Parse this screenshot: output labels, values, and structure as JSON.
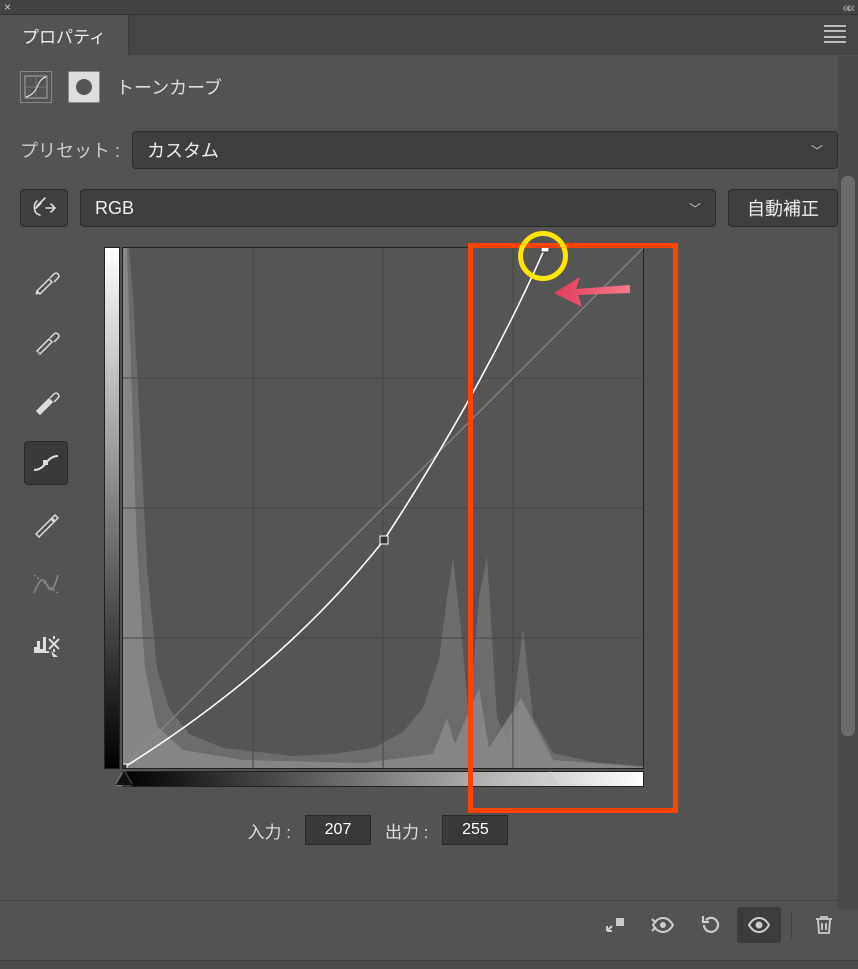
{
  "panel": {
    "tab_title": "プロパティ",
    "adjustment_title": "トーンカーブ"
  },
  "preset": {
    "label": "プリセット :",
    "value": "カスタム"
  },
  "channel": {
    "value": "RGB",
    "auto_label": "自動補正"
  },
  "io": {
    "input_label": "入力 :",
    "input_value": "207",
    "output_label": "出力 :",
    "output_value": "255"
  },
  "icons": {
    "hand": "hand-modify-icon",
    "eyedrop_black": "eyedropper-black-point",
    "eyedrop_gray": "eyedropper-gray-point",
    "eyedrop_white": "eyedropper-white-point",
    "curve_tool": "curve-point-tool",
    "pencil": "pencil-freehand-tool",
    "smooth": "smooth-curve-tool",
    "clip_hist": "clip-histogram-tool"
  },
  "chart_data": {
    "type": "line",
    "title": "トーンカーブ",
    "xlabel": "入力",
    "ylabel": "出力",
    "xlim": [
      0,
      255
    ],
    "ylim": [
      0,
      255
    ],
    "series": [
      {
        "name": "baseline",
        "x": [
          0,
          255
        ],
        "y": [
          0,
          255
        ]
      },
      {
        "name": "curve",
        "x": [
          0,
          128,
          207
        ],
        "y": [
          0,
          112,
          255
        ]
      }
    ],
    "control_points": [
      {
        "x": 0,
        "y": 0
      },
      {
        "x": 128,
        "y": 112
      },
      {
        "x": 207,
        "y": 255
      }
    ],
    "sliders": {
      "black": 0,
      "white": 207
    },
    "histogram_peaks_approx": [
      0,
      5,
      12,
      160,
      172,
      196,
      244
    ]
  }
}
